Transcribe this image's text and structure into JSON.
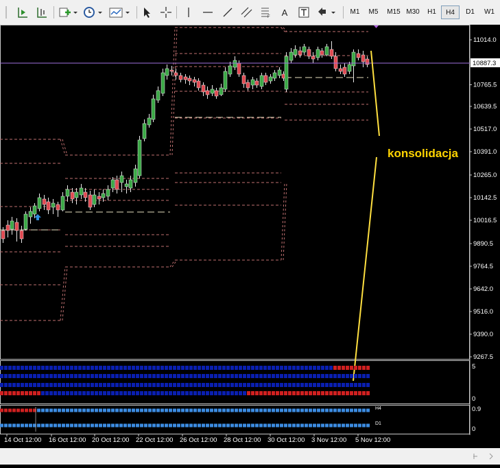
{
  "toolbar": {
    "timeframes": [
      "M1",
      "M5",
      "M15",
      "M30",
      "H1",
      "H4",
      "D1",
      "W1"
    ],
    "active_timeframe": "H4",
    "tools": [
      "new-chart-icon",
      "indicators-icon",
      "clock-icon",
      "templates-icon",
      "cursor-icon",
      "crosshair-icon",
      "vertical-line-icon",
      "horizontal-line-icon",
      "trendline-icon",
      "channel-icon",
      "fibonacci-icon",
      "text-icon",
      "text-label-icon",
      "arrows-icon"
    ],
    "text_tool_glyph": "A"
  },
  "chart": {
    "annotation": "konsolidacja",
    "annotation_color": "#ffd400",
    "current_price": "10887.3",
    "price_labels": [
      "11014.0",
      "10887.3",
      "10765.5",
      "10639.5",
      "10517.0",
      "10391.0",
      "10265.0",
      "10142.5",
      "10016.5",
      "9890.5",
      "9764.5",
      "9642.0",
      "9516.0",
      "9390.0",
      "9267.5"
    ],
    "time_labels": [
      "14 Oct 12:00",
      "16 Oct 12:00",
      "20 Oct 12:00",
      "22 Oct 12:00",
      "26 Oct 12:00",
      "28 Oct 12:00",
      "30 Oct 12:00",
      "3 Nov 12:00",
      "5 Nov 12:00"
    ],
    "bull_color": "#3aa845",
    "bear_color": "#e04850",
    "level_color": "#c07070",
    "mid_level_color": "#e8e0c0"
  },
  "indicator1": {
    "scale_top": "5",
    "scale_bottom": "0",
    "blue": "#0a1fb0",
    "red": "#d02020"
  },
  "indicator2": {
    "scale_top": "0.9",
    "scale_bottom": "0",
    "label_top": "H4",
    "label_bottom": "D1",
    "blue": "#3c8be0",
    "red": "#d02020"
  }
}
